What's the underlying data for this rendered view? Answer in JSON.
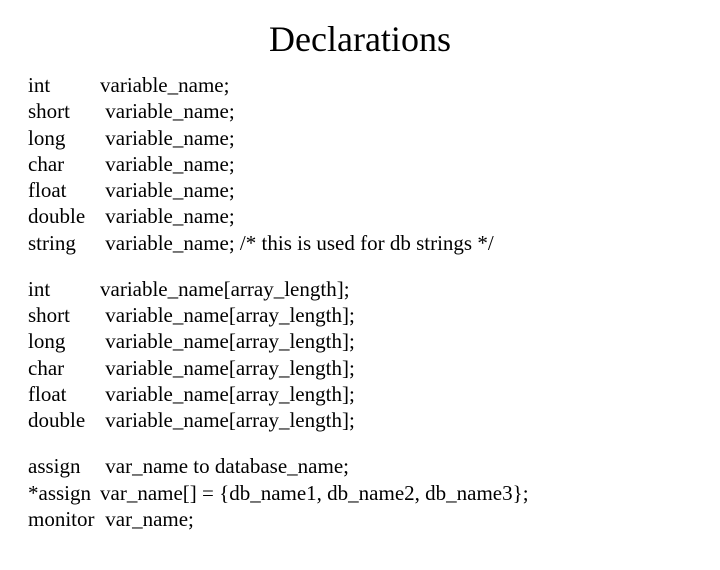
{
  "title": "Declarations",
  "block1": [
    {
      "kw": "int",
      "rest": "variable_name;"
    },
    {
      "kw": "short",
      "rest": " variable_name;"
    },
    {
      "kw": "long",
      "rest": " variable_name;"
    },
    {
      "kw": "char",
      "rest": " variable_name;"
    },
    {
      "kw": "float",
      "rest": " variable_name;"
    },
    {
      "kw": "double",
      "rest": " variable_name;"
    },
    {
      "kw": "string",
      "rest": " variable_name; /* this is used for db strings */"
    }
  ],
  "block2": [
    {
      "kw": "int",
      "rest": "variable_name[array_length];"
    },
    {
      "kw": "short",
      "rest": " variable_name[array_length];"
    },
    {
      "kw": "long",
      "rest": " variable_name[array_length];"
    },
    {
      "kw": "char",
      "rest": " variable_name[array_length];"
    },
    {
      "kw": "float",
      "rest": " variable_name[array_length];"
    },
    {
      "kw": "double",
      "rest": " variable_name[array_length];"
    }
  ],
  "block3": [
    {
      "kw": "assign",
      "rest": " var_name to database_name;"
    },
    {
      "kw": "*assign",
      "rest": "var_name[] = {db_name1, db_name2, db_name3};"
    },
    {
      "kw": "monitor",
      "rest": " var_name;"
    }
  ]
}
